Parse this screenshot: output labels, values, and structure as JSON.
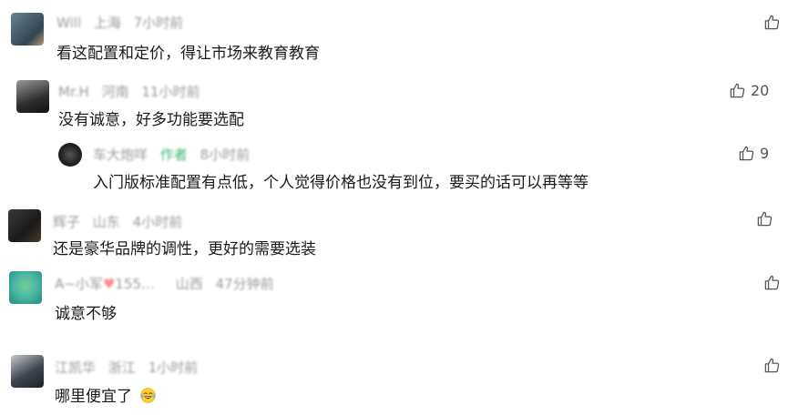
{
  "comments": [
    {
      "user": "Will",
      "location": "上海",
      "time": "7小时前",
      "text": "看这配置和定价，得让市场来教育教育",
      "likes": "",
      "avatar_color": "#4a6272"
    },
    {
      "user": "Mr.H",
      "location": "河南",
      "time": "11小时前",
      "text": "没有诚意，好多功能要选配",
      "likes": "20",
      "avatar_color": "#3a3a3a"
    },
    {
      "user": "车大炮咩",
      "author_tag": "作者",
      "time": "8小时前",
      "text": "入门版标准配置有点低，个人觉得价格也没有到位，要买的话可以再等等",
      "likes": "9",
      "avatar_color": "#1f1f1f"
    },
    {
      "user": "辉子",
      "location": "山东",
      "time": "4小时前",
      "text": "还是豪华品牌的调性，更好的需要选装",
      "likes": "",
      "avatar_color": "#2b2b2b"
    },
    {
      "user_prefix": "A~小军",
      "user_highlight": "♥",
      "user_suffix": "155…",
      "location": "山西",
      "time": "47分钟前",
      "text": "诚意不够",
      "likes": "",
      "avatar_color": "#4fb8a6"
    },
    {
      "user": "江凯华",
      "location": "浙江",
      "time": "1小时前",
      "text": "哪里便宜了",
      "likes": "",
      "avatar_color": "#3d4550"
    }
  ],
  "icons": {
    "like": "thumbs-up-outline-icon",
    "emoji": "face-with-tears-of-joy-emoji"
  }
}
